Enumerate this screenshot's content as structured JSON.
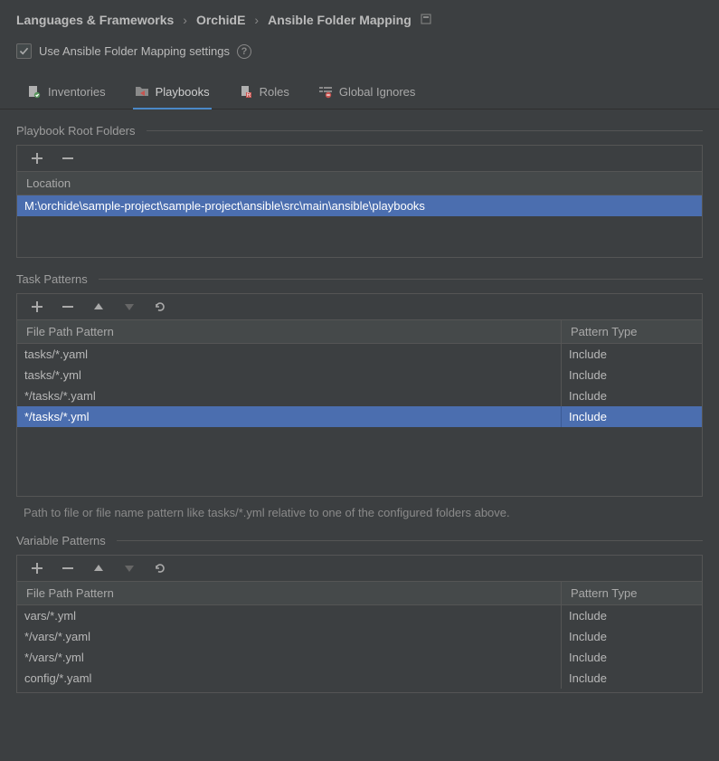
{
  "breadcrumb": {
    "items": [
      "Languages & Frameworks",
      "OrchidE",
      "Ansible Folder Mapping"
    ]
  },
  "checkbox": {
    "label": "Use Ansible Folder Mapping settings"
  },
  "tabs": [
    {
      "label": "Inventories"
    },
    {
      "label": "Playbooks"
    },
    {
      "label": "Roles"
    },
    {
      "label": "Global Ignores"
    }
  ],
  "sections": {
    "rootFolders": {
      "title": "Playbook Root Folders",
      "headers": [
        "Location"
      ],
      "rows": [
        {
          "location": "M:\\orchide\\sample-project\\sample-project\\ansible\\src\\main\\ansible\\playbooks",
          "selected": true
        }
      ]
    },
    "taskPatterns": {
      "title": "Task Patterns",
      "headers": [
        "File Path Pattern",
        "Pattern Type"
      ],
      "rows": [
        {
          "pattern": "tasks/*.yaml",
          "type": "Include"
        },
        {
          "pattern": "tasks/*.yml",
          "type": "Include"
        },
        {
          "pattern": "*/tasks/*.yaml",
          "type": "Include"
        },
        {
          "pattern": "*/tasks/*.yml",
          "type": "Include",
          "selected": true
        }
      ],
      "hint": "Path to file or file name pattern like tasks/*.yml relative to one of the configured folders above."
    },
    "variablePatterns": {
      "title": "Variable Patterns",
      "headers": [
        "File Path Pattern",
        "Pattern Type"
      ],
      "rows": [
        {
          "pattern": "vars/*.yml",
          "type": "Include"
        },
        {
          "pattern": "*/vars/*.yaml",
          "type": "Include"
        },
        {
          "pattern": "*/vars/*.yml",
          "type": "Include"
        },
        {
          "pattern": "config/*.yaml",
          "type": "Include"
        }
      ]
    }
  }
}
